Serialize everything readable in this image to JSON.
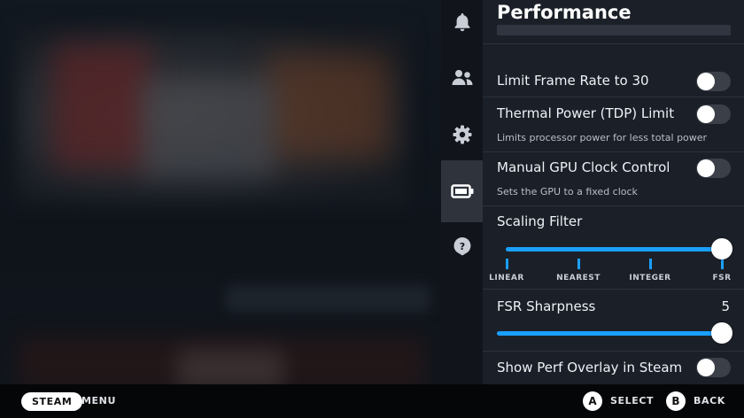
{
  "panel": {
    "title": "Performance",
    "rows": [
      {
        "label": "Limit Frame Rate to 30",
        "toggle_on": false
      },
      {
        "label": "Thermal Power (TDP) Limit",
        "description": "Limits processor power for less total power",
        "toggle_on": false
      },
      {
        "label": "Manual GPU Clock Control",
        "description": "Sets the GPU to a fixed clock",
        "toggle_on": false
      },
      {
        "label": "Scaling Filter",
        "options": [
          "LINEAR",
          "NEAREST",
          "INTEGER",
          "FSR"
        ],
        "selected": "FSR"
      },
      {
        "label": "FSR Sharpness",
        "value": "5",
        "level": 1.0
      },
      {
        "label": "Show Perf Overlay in Steam",
        "toggle_on": false
      }
    ]
  },
  "rail": {
    "icons": [
      "bell-icon",
      "friends-icon",
      "gear-icon",
      "battery-icon",
      "help-icon"
    ],
    "active": "battery-icon"
  },
  "bottom_bar": {
    "steam_label": "STEAM",
    "menu_label": "MENU",
    "a_glyph": "A",
    "select_label": "SELECT",
    "b_glyph": "B",
    "back_label": "BACK"
  },
  "colors": {
    "accent": "#1a9fff",
    "panel_bg": "#1b2028",
    "rail_bg": "#11141a",
    "toggle_off": "#3a3f48"
  }
}
